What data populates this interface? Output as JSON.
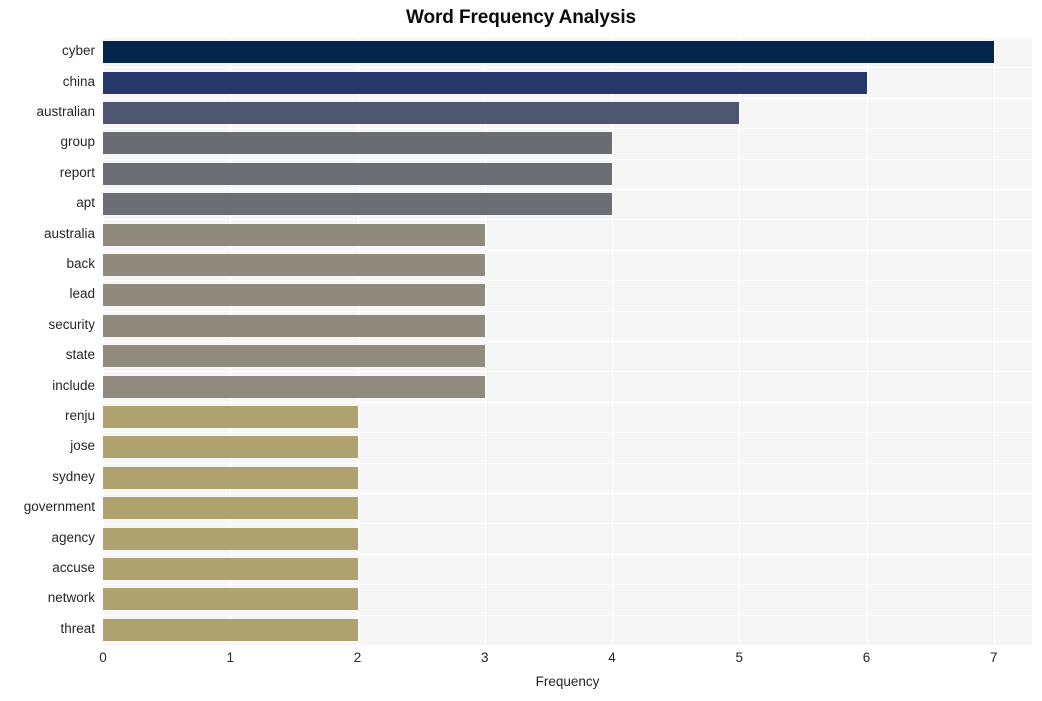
{
  "chart_data": {
    "type": "bar",
    "orientation": "horizontal",
    "title": "Word Frequency Analysis",
    "xlabel": "Frequency",
    "ylabel": "",
    "categories": [
      "cyber",
      "china",
      "australian",
      "group",
      "report",
      "apt",
      "australia",
      "back",
      "lead",
      "security",
      "state",
      "include",
      "renju",
      "jose",
      "sydney",
      "government",
      "agency",
      "accuse",
      "network",
      "threat"
    ],
    "values": [
      7,
      6,
      5,
      4,
      4,
      4,
      3,
      3,
      3,
      3,
      3,
      3,
      2,
      2,
      2,
      2,
      2,
      2,
      2,
      2
    ],
    "xlim": [
      0,
      7.3
    ],
    "xticks": [
      0,
      1,
      2,
      3,
      4,
      5,
      6,
      7
    ],
    "xticklabels": [
      "0",
      "1",
      "2",
      "3",
      "4",
      "5",
      "6",
      "7"
    ],
    "grid": true,
    "grid_color": "#ffffff",
    "plot_background": "#f6f6f6",
    "figure_background": "#ffffff",
    "legend": null,
    "bar_colors": [
      "#04264d",
      "#26386b",
      "#4d5570",
      "#6b6c72",
      "#6c6d73",
      "#6d6e74",
      "#8e8a7c",
      "#8e8a7c",
      "#8e8a7c",
      "#8e8a7c",
      "#8f8b7d",
      "#8f8b7d",
      "#aea36f",
      "#aea36f",
      "#aea36f",
      "#aea36f",
      "#aea36f",
      "#aea36f",
      "#aea36f",
      "#aea36f"
    ]
  },
  "axes": {
    "x_tick_labels": [
      "0",
      "1",
      "2",
      "3",
      "4",
      "5",
      "6",
      "7"
    ],
    "x_axis_title": "Frequency",
    "y_tick_labels": [
      "cyber",
      "china",
      "australian",
      "group",
      "report",
      "apt",
      "australia",
      "back",
      "lead",
      "security",
      "state",
      "include",
      "renju",
      "jose",
      "sydney",
      "government",
      "agency",
      "accuse",
      "network",
      "threat"
    ]
  },
  "title": "Word Frequency Analysis"
}
